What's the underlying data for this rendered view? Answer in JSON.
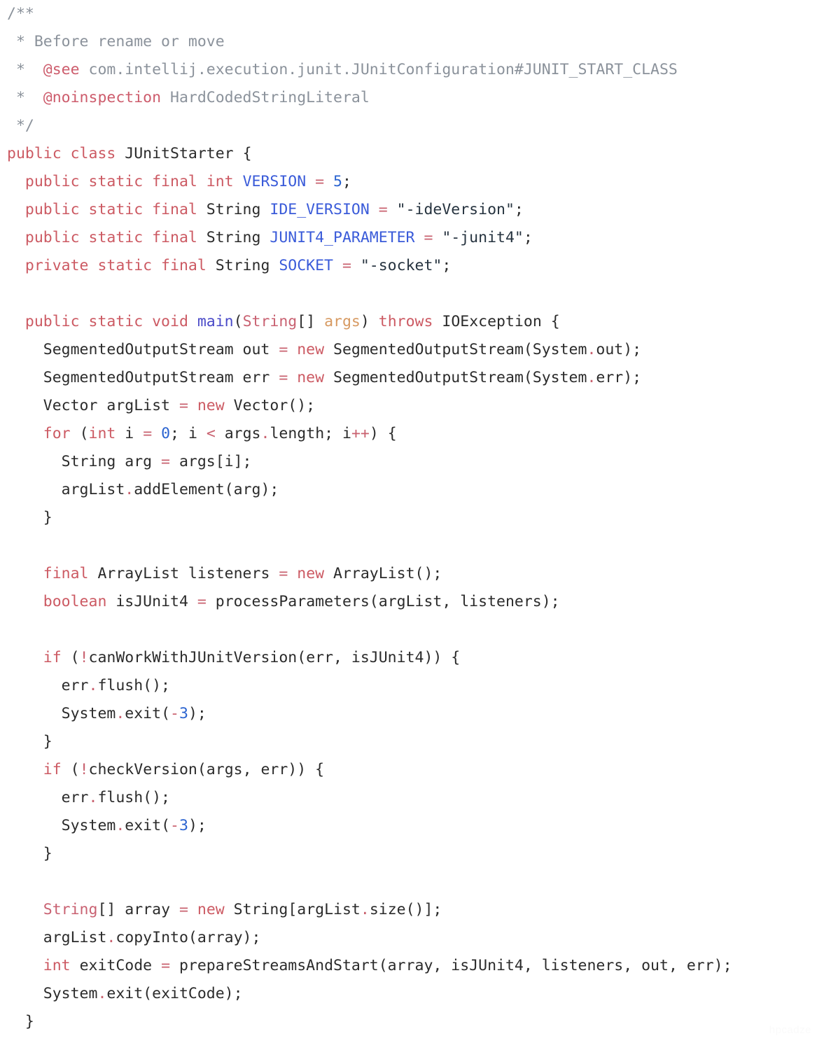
{
  "editor": {
    "language": "java",
    "background_color": "#ffffff",
    "watermark": "hpcadze",
    "colors": {
      "keyword": "#cc5a63",
      "comment": "#8b929b",
      "javadoc_tag": "#cd5c6c",
      "constant": "#3a5bd9",
      "number": "#2a63d0",
      "string": "#26333f",
      "type": "#2b2b2b",
      "declared_type": "#c96272",
      "method": "#4a4ac8",
      "parameter": "#d79a62",
      "operator": "#c9616f",
      "plain": "#2b2b2b"
    }
  },
  "code": {
    "lines": [
      {
        "indent": 0,
        "tokens": [
          {
            "t": "cmt",
            "v": "/**"
          }
        ]
      },
      {
        "indent": 0,
        "tokens": [
          {
            "t": "cmt",
            "v": " * Before rename or move"
          }
        ]
      },
      {
        "indent": 0,
        "tokens": [
          {
            "t": "cmt",
            "v": " *  "
          },
          {
            "t": "tag",
            "v": "@see"
          },
          {
            "t": "cmt",
            "v": " com.intellij.execution.junit.JUnitConfiguration#JUNIT_START_CLASS"
          }
        ]
      },
      {
        "indent": 0,
        "tokens": [
          {
            "t": "cmt",
            "v": " *  "
          },
          {
            "t": "tag",
            "v": "@noinspection"
          },
          {
            "t": "cmt",
            "v": " HardCodedStringLiteral"
          }
        ]
      },
      {
        "indent": 0,
        "tokens": [
          {
            "t": "cmt",
            "v": " */"
          }
        ]
      },
      {
        "indent": 0,
        "tokens": [
          {
            "t": "kw",
            "v": "public class "
          },
          {
            "t": "type",
            "v": "JUnitStarter"
          },
          {
            "t": "punc",
            "v": " {"
          }
        ]
      },
      {
        "indent": 0,
        "tokens": [
          {
            "t": "plain",
            "v": "  "
          },
          {
            "t": "kw",
            "v": "public static final int "
          },
          {
            "t": "const",
            "v": "VERSION"
          },
          {
            "t": "op",
            "v": " = "
          },
          {
            "t": "num",
            "v": "5"
          },
          {
            "t": "punc",
            "v": ";"
          }
        ]
      },
      {
        "indent": 0,
        "tokens": [
          {
            "t": "plain",
            "v": "  "
          },
          {
            "t": "kw",
            "v": "public static final "
          },
          {
            "t": "type",
            "v": "String "
          },
          {
            "t": "const",
            "v": "IDE_VERSION"
          },
          {
            "t": "op",
            "v": " = "
          },
          {
            "t": "str",
            "v": "\"-ideVersion\""
          },
          {
            "t": "punc",
            "v": ";"
          }
        ]
      },
      {
        "indent": 0,
        "tokens": [
          {
            "t": "plain",
            "v": "  "
          },
          {
            "t": "kw",
            "v": "public static final "
          },
          {
            "t": "type",
            "v": "String "
          },
          {
            "t": "const",
            "v": "JUNIT4_PARAMETER"
          },
          {
            "t": "op",
            "v": " = "
          },
          {
            "t": "str",
            "v": "\"-junit4\""
          },
          {
            "t": "punc",
            "v": ";"
          }
        ]
      },
      {
        "indent": 0,
        "tokens": [
          {
            "t": "plain",
            "v": "  "
          },
          {
            "t": "kw",
            "v": "private static final "
          },
          {
            "t": "type",
            "v": "String "
          },
          {
            "t": "const",
            "v": "SOCKET"
          },
          {
            "t": "op",
            "v": " = "
          },
          {
            "t": "str",
            "v": "\"-socket\""
          },
          {
            "t": "punc",
            "v": ";"
          }
        ]
      },
      {
        "indent": 0,
        "tokens": [
          {
            "t": "plain",
            "v": ""
          }
        ]
      },
      {
        "indent": 0,
        "tokens": [
          {
            "t": "plain",
            "v": "  "
          },
          {
            "t": "kw",
            "v": "public static void "
          },
          {
            "t": "method",
            "v": "main"
          },
          {
            "t": "punc",
            "v": "("
          },
          {
            "t": "typekw",
            "v": "String"
          },
          {
            "t": "punc",
            "v": "[] "
          },
          {
            "t": "param",
            "v": "args"
          },
          {
            "t": "punc",
            "v": ") "
          },
          {
            "t": "kw",
            "v": "throws "
          },
          {
            "t": "type",
            "v": "IOException"
          },
          {
            "t": "punc",
            "v": " {"
          }
        ]
      },
      {
        "indent": 0,
        "tokens": [
          {
            "t": "plain",
            "v": "    SegmentedOutputStream out"
          },
          {
            "t": "op",
            "v": " = "
          },
          {
            "t": "kw",
            "v": "new "
          },
          {
            "t": "plain",
            "v": "SegmentedOutputStream(System"
          },
          {
            "t": "op",
            "v": "."
          },
          {
            "t": "plain",
            "v": "out);"
          }
        ]
      },
      {
        "indent": 0,
        "tokens": [
          {
            "t": "plain",
            "v": "    SegmentedOutputStream err"
          },
          {
            "t": "op",
            "v": " = "
          },
          {
            "t": "kw",
            "v": "new "
          },
          {
            "t": "plain",
            "v": "SegmentedOutputStream(System"
          },
          {
            "t": "op",
            "v": "."
          },
          {
            "t": "plain",
            "v": "err);"
          }
        ]
      },
      {
        "indent": 0,
        "tokens": [
          {
            "t": "plain",
            "v": "    Vector argList"
          },
          {
            "t": "op",
            "v": " = "
          },
          {
            "t": "kw",
            "v": "new "
          },
          {
            "t": "plain",
            "v": "Vector();"
          }
        ]
      },
      {
        "indent": 0,
        "tokens": [
          {
            "t": "plain",
            "v": "    "
          },
          {
            "t": "kw",
            "v": "for "
          },
          {
            "t": "punc",
            "v": "("
          },
          {
            "t": "kw",
            "v": "int "
          },
          {
            "t": "plain",
            "v": "i"
          },
          {
            "t": "op",
            "v": " = "
          },
          {
            "t": "num",
            "v": "0"
          },
          {
            "t": "punc",
            "v": "; "
          },
          {
            "t": "plain",
            "v": "i "
          },
          {
            "t": "op",
            "v": "<"
          },
          {
            "t": "plain",
            "v": " args"
          },
          {
            "t": "op",
            "v": "."
          },
          {
            "t": "plain",
            "v": "length; i"
          },
          {
            "t": "op",
            "v": "++"
          },
          {
            "t": "punc",
            "v": ") {"
          }
        ]
      },
      {
        "indent": 0,
        "tokens": [
          {
            "t": "plain",
            "v": "      String arg"
          },
          {
            "t": "op",
            "v": " = "
          },
          {
            "t": "plain",
            "v": "args[i];"
          }
        ]
      },
      {
        "indent": 0,
        "tokens": [
          {
            "t": "plain",
            "v": "      argList"
          },
          {
            "t": "op",
            "v": "."
          },
          {
            "t": "plain",
            "v": "addElement(arg);"
          }
        ]
      },
      {
        "indent": 0,
        "tokens": [
          {
            "t": "plain",
            "v": "    }"
          }
        ]
      },
      {
        "indent": 0,
        "tokens": [
          {
            "t": "plain",
            "v": ""
          }
        ]
      },
      {
        "indent": 0,
        "tokens": [
          {
            "t": "plain",
            "v": "    "
          },
          {
            "t": "kw",
            "v": "final "
          },
          {
            "t": "plain",
            "v": "ArrayList listeners"
          },
          {
            "t": "op",
            "v": " = "
          },
          {
            "t": "kw",
            "v": "new "
          },
          {
            "t": "plain",
            "v": "ArrayList();"
          }
        ]
      },
      {
        "indent": 0,
        "tokens": [
          {
            "t": "plain",
            "v": "    "
          },
          {
            "t": "kw",
            "v": "boolean "
          },
          {
            "t": "plain",
            "v": "isJUnit4"
          },
          {
            "t": "op",
            "v": " = "
          },
          {
            "t": "plain",
            "v": "processParameters(argList, listeners);"
          }
        ]
      },
      {
        "indent": 0,
        "tokens": [
          {
            "t": "plain",
            "v": ""
          }
        ]
      },
      {
        "indent": 0,
        "tokens": [
          {
            "t": "plain",
            "v": "    "
          },
          {
            "t": "kw",
            "v": "if "
          },
          {
            "t": "punc",
            "v": "("
          },
          {
            "t": "op",
            "v": "!"
          },
          {
            "t": "plain",
            "v": "canWorkWithJUnitVersion(err, isJUnit4)) {"
          }
        ]
      },
      {
        "indent": 0,
        "tokens": [
          {
            "t": "plain",
            "v": "      err"
          },
          {
            "t": "op",
            "v": "."
          },
          {
            "t": "plain",
            "v": "flush();"
          }
        ]
      },
      {
        "indent": 0,
        "tokens": [
          {
            "t": "plain",
            "v": "      System"
          },
          {
            "t": "op",
            "v": "."
          },
          {
            "t": "plain",
            "v": "exit("
          },
          {
            "t": "op",
            "v": "-"
          },
          {
            "t": "num",
            "v": "3"
          },
          {
            "t": "punc",
            "v": ");"
          }
        ]
      },
      {
        "indent": 0,
        "tokens": [
          {
            "t": "plain",
            "v": "    }"
          }
        ]
      },
      {
        "indent": 0,
        "tokens": [
          {
            "t": "plain",
            "v": "    "
          },
          {
            "t": "kw",
            "v": "if "
          },
          {
            "t": "punc",
            "v": "("
          },
          {
            "t": "op",
            "v": "!"
          },
          {
            "t": "plain",
            "v": "checkVersion(args, err)) {"
          }
        ]
      },
      {
        "indent": 0,
        "tokens": [
          {
            "t": "plain",
            "v": "      err"
          },
          {
            "t": "op",
            "v": "."
          },
          {
            "t": "plain",
            "v": "flush();"
          }
        ]
      },
      {
        "indent": 0,
        "tokens": [
          {
            "t": "plain",
            "v": "      System"
          },
          {
            "t": "op",
            "v": "."
          },
          {
            "t": "plain",
            "v": "exit("
          },
          {
            "t": "op",
            "v": "-"
          },
          {
            "t": "num",
            "v": "3"
          },
          {
            "t": "punc",
            "v": ");"
          }
        ]
      },
      {
        "indent": 0,
        "tokens": [
          {
            "t": "plain",
            "v": "    }"
          }
        ]
      },
      {
        "indent": 0,
        "tokens": [
          {
            "t": "plain",
            "v": ""
          }
        ]
      },
      {
        "indent": 0,
        "tokens": [
          {
            "t": "plain",
            "v": "    "
          },
          {
            "t": "typekw",
            "v": "String"
          },
          {
            "t": "punc",
            "v": "[] "
          },
          {
            "t": "plain",
            "v": "array"
          },
          {
            "t": "op",
            "v": " = "
          },
          {
            "t": "kw",
            "v": "new "
          },
          {
            "t": "plain",
            "v": "String[argList"
          },
          {
            "t": "op",
            "v": "."
          },
          {
            "t": "plain",
            "v": "size()];"
          }
        ]
      },
      {
        "indent": 0,
        "tokens": [
          {
            "t": "plain",
            "v": "    argList"
          },
          {
            "t": "op",
            "v": "."
          },
          {
            "t": "plain",
            "v": "copyInto(array);"
          }
        ]
      },
      {
        "indent": 0,
        "tokens": [
          {
            "t": "plain",
            "v": "    "
          },
          {
            "t": "kw",
            "v": "int "
          },
          {
            "t": "plain",
            "v": "exitCode"
          },
          {
            "t": "op",
            "v": " = "
          },
          {
            "t": "plain",
            "v": "prepareStreamsAndStart(array, isJUnit4, listeners, out, err);"
          }
        ]
      },
      {
        "indent": 0,
        "tokens": [
          {
            "t": "plain",
            "v": "    System"
          },
          {
            "t": "op",
            "v": "."
          },
          {
            "t": "plain",
            "v": "exit(exitCode);"
          }
        ]
      },
      {
        "indent": 0,
        "tokens": [
          {
            "t": "plain",
            "v": "  }"
          }
        ]
      }
    ],
    "plain_text": "/**\n * Before rename or move\n *  @see com.intellij.execution.junit.JUnitConfiguration#JUNIT_START_CLASS\n *  @noinspection HardCodedStringLiteral\n */\npublic class JUnitStarter {\n  public static final int VERSION = 5;\n  public static final String IDE_VERSION = \"-ideVersion\";\n  public static final String JUNIT4_PARAMETER = \"-junit4\";\n  private static final String SOCKET = \"-socket\";\n\n  public static void main(String[] args) throws IOException {\n    SegmentedOutputStream out = new SegmentedOutputStream(System.out);\n    SegmentedOutputStream err = new SegmentedOutputStream(System.err);\n    Vector argList = new Vector();\n    for (int i = 0; i < args.length; i++) {\n      String arg = args[i];\n      argList.addElement(arg);\n    }\n\n    final ArrayList listeners = new ArrayList();\n    boolean isJUnit4 = processParameters(argList, listeners);\n\n    if (!canWorkWithJUnitVersion(err, isJUnit4)) {\n      err.flush();\n      System.exit(-3);\n    }\n    if (!checkVersion(args, err)) {\n      err.flush();\n      System.exit(-3);\n    }\n\n    String[] array = new String[argList.size()];\n    argList.copyInto(array);\n    int exitCode = prepareStreamsAndStart(array, isJUnit4, listeners, out, err);\n    System.exit(exitCode);\n  }"
  }
}
